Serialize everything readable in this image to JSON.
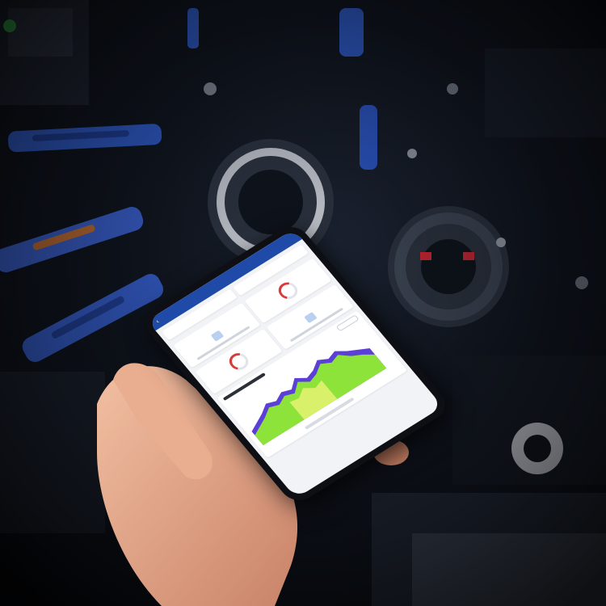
{
  "scene": {
    "description_free": true
  },
  "phone_app": {
    "appbar_title": "",
    "sections": [
      {
        "label": ""
      },
      {
        "label": ""
      }
    ],
    "chart": {
      "title": "",
      "series_colors": [
        "#5b3fd6",
        "#8ee33a",
        "#d9f06a"
      ],
      "accent": "#1f4aa8"
    }
  },
  "colors": {
    "app_bar": "#1f4aa8",
    "gauge": "#d83b3b",
    "screen_bg": "#f2f3f6",
    "machine_blue": "#2f5fd8",
    "machine_dark": "#161b24"
  }
}
